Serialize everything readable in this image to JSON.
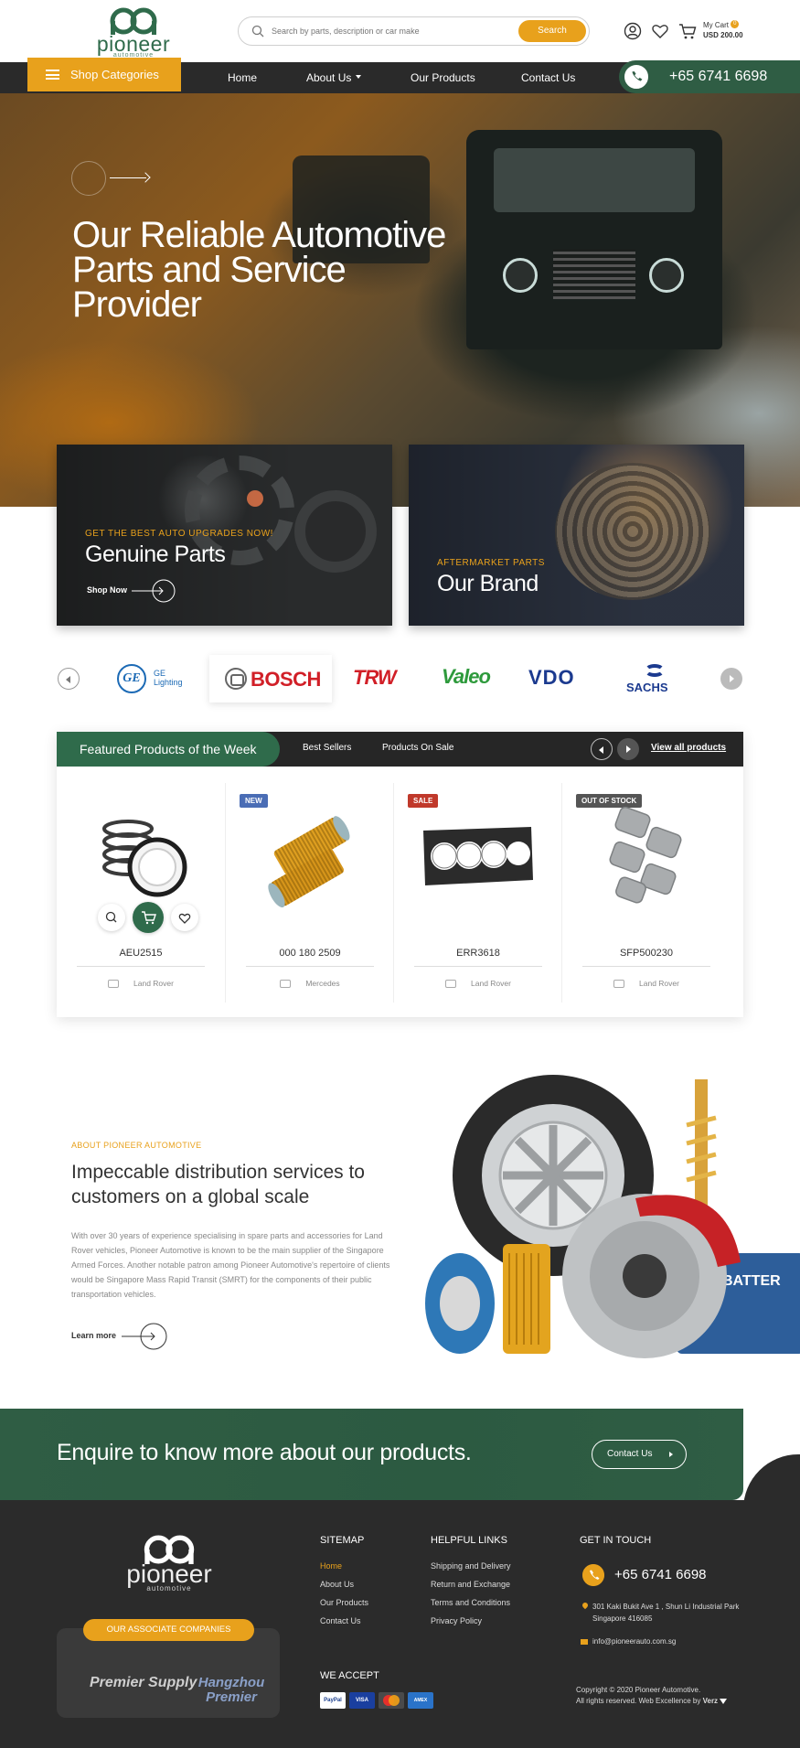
{
  "header": {
    "logo_word": "pioneer",
    "logo_sub": "automotive",
    "search_placeholder": "Search by parts, description or car make",
    "search_button": "Search",
    "cart_label": "My Cart",
    "cart_count": "0",
    "cart_total": "USD 200.00"
  },
  "nav": {
    "shop_categories": "Shop Categories",
    "links": [
      "Home",
      "About Us",
      "Our Products",
      "Contact Us"
    ],
    "phone": "+65 6741 6698"
  },
  "hero": {
    "headline": "Our Reliable Automotive Parts and Service Provider"
  },
  "promos": [
    {
      "kicker": "GET THE BEST AUTO UPGRADES NOW!",
      "title": "Genuine Parts",
      "cta": "Shop Now"
    },
    {
      "kicker": "AFTERMARKET PARTS",
      "title": "Our Brand"
    }
  ],
  "brands": [
    {
      "name": "GE Lighting",
      "mark": "GE",
      "line1": "GE",
      "line2": "Lighting"
    },
    {
      "name": "BOSCH"
    },
    {
      "name": "TRW"
    },
    {
      "name": "Valeo"
    },
    {
      "name": "VDO"
    },
    {
      "name": "SACHS"
    }
  ],
  "featured": {
    "title": "Featured Products of the Week",
    "tabs": [
      "Best Sellers",
      "Products On Sale"
    ],
    "view_all": "View all products",
    "products": [
      {
        "code": "AEU2515",
        "brand": "Land Rover",
        "badge": ""
      },
      {
        "code": "000 180 2509",
        "brand": "Mercedes",
        "badge": "NEW"
      },
      {
        "code": "ERR3618",
        "brand": "Land Rover",
        "badge": "SALE"
      },
      {
        "code": "SFP500230",
        "brand": "Land Rover",
        "badge": "OUT OF STOCK"
      }
    ]
  },
  "about": {
    "kicker": "ABOUT PIONEER AUTOMOTIVE",
    "title": "Impeccable distribution services to customers on a global scale",
    "body": "With over 30 years of experience specialising in spare parts and accessories for Land Rover vehicles, Pioneer Automotive is known to be the main supplier of the Singapore Armed Forces. Another notable patron among Pioneer Automotive's repertoire of clients would be Singapore Mass Rapid Transit (SMRT) for the components of their public transportation vehicles.",
    "learn_more": "Learn more",
    "battery_label": "BATTER"
  },
  "enquire": {
    "text": "Enquire to know more about our products.",
    "button": "Contact Us"
  },
  "footer": {
    "logo_word": "pioneer",
    "logo_sub": "automotive",
    "associate_label": "OUR ASSOCIATE COMPANIES",
    "associates": [
      "Premier Supply",
      "Hangzhou Premier"
    ],
    "sitemap_title": "SITEMAP",
    "sitemap": [
      "Home",
      "About Us",
      "Our Products",
      "Contact Us"
    ],
    "helpful_title": "HELPFUL LINKS",
    "helpful": [
      "Shipping and Delivery",
      "Return and Exchange",
      "Terms and Conditions",
      "Privacy Policy"
    ],
    "contact_title": "GET IN TOUCH",
    "phone": "+65 6741 6698",
    "address": "301 Kaki Bukit Ave 1 , Shun Li Industrial Park Singapore 416085",
    "email": "info@pioneerauto.com.sg",
    "accept_title": "WE ACCEPT",
    "cards": [
      "PayPal",
      "VISA",
      "Mastercard",
      "AMEX"
    ],
    "copyright_line1": "Copyright © 2020 Pioneer Automotive.",
    "copyright_line2": "All rights reserved. Web Excellence by",
    "credit": "Verz"
  },
  "colors": {
    "green": "#2f6b4b",
    "orange": "#e8a11c",
    "dark": "#2b2b2b"
  }
}
